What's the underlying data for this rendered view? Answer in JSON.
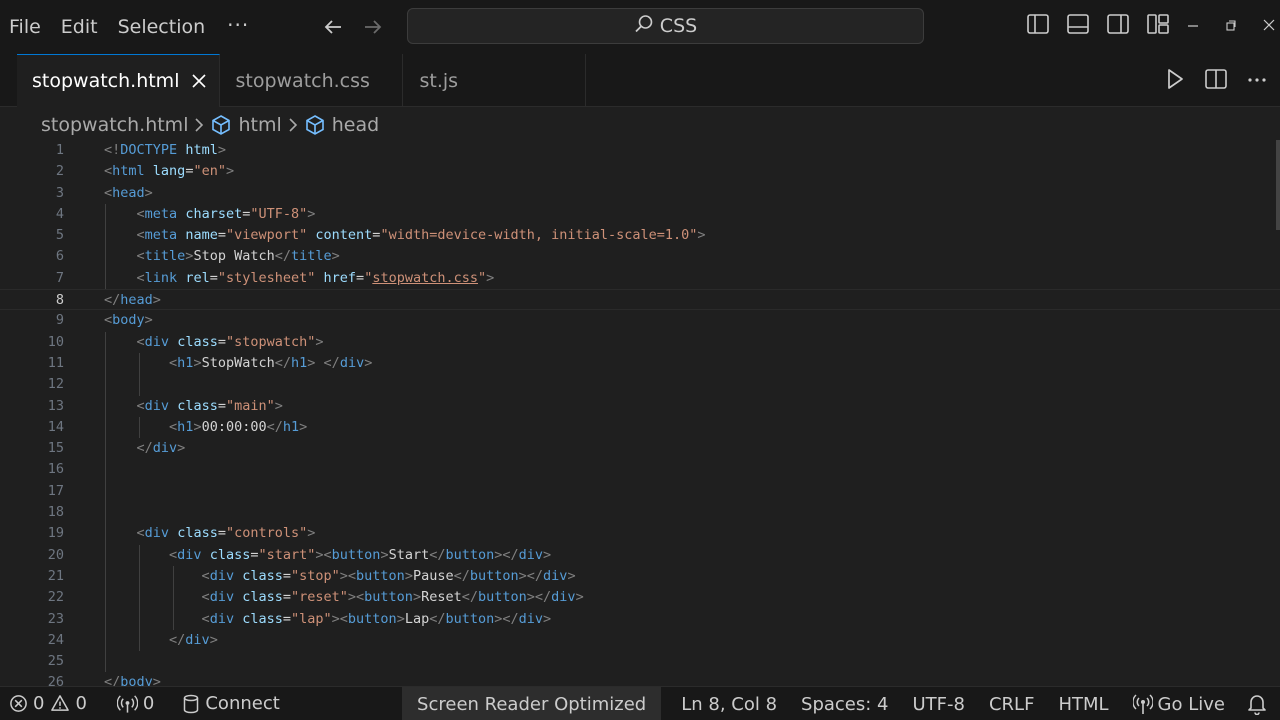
{
  "menu": {
    "items": [
      "File",
      "Edit",
      "Selection"
    ],
    "more": "···"
  },
  "command_center": {
    "text": "CSS"
  },
  "tabs": [
    {
      "label": "stopwatch.html",
      "active": true
    },
    {
      "label": "stopwatch.css",
      "active": false
    },
    {
      "label": "st.js",
      "active": false
    }
  ],
  "breadcrumb": [
    "stopwatch.html",
    "html",
    "head"
  ],
  "editor": {
    "current_line": 8,
    "line_numbers": [
      "1",
      "2",
      "3",
      "4",
      "5",
      "6",
      "7",
      "8",
      "9",
      "10",
      "11",
      "12",
      "13",
      "14",
      "15",
      "16",
      "17",
      "18",
      "19",
      "20",
      "21",
      "22",
      "23",
      "24",
      "25",
      "26"
    ]
  },
  "status": {
    "errors": "0",
    "warnings": "0",
    "ports": "0",
    "connect": "Connect",
    "screen_reader": "Screen Reader Optimized",
    "position": "Ln 8, Col 8",
    "spaces": "Spaces: 4",
    "encoding": "UTF-8",
    "eol": "CRLF",
    "language": "HTML",
    "go_live": "Go Live"
  },
  "colors": {
    "accent": "#0078d4",
    "background": "#1f1f1f",
    "tag": "#569cd6",
    "attribute": "#9cdcfe",
    "string": "#ce9178"
  }
}
